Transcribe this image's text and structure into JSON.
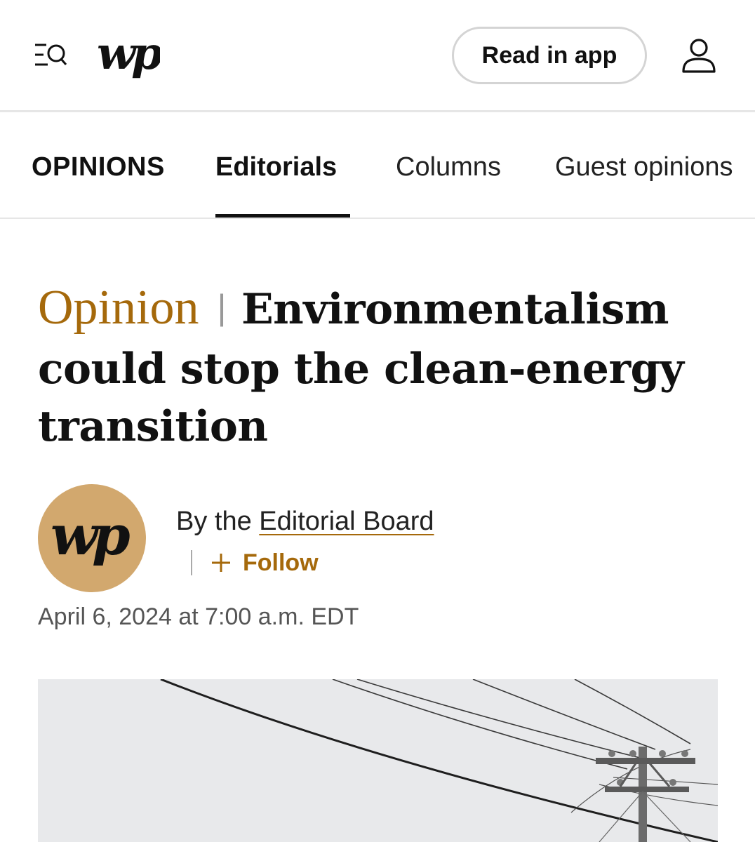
{
  "header": {
    "menu_icon": "menu-search-icon",
    "logo_text": "wp",
    "read_in_app_label": "Read in app",
    "account_icon": "user-icon"
  },
  "section_nav": {
    "items": [
      {
        "label": "OPINIONS",
        "active": false
      },
      {
        "label": "Editorials",
        "active": true
      },
      {
        "label": "Columns",
        "active": false
      },
      {
        "label": "Guest opinions",
        "active": false
      }
    ]
  },
  "article": {
    "kicker": "Opinion",
    "separator": "|",
    "headline": "Environmentalism could stop the clean-energy transition",
    "byline_prefix": "By the ",
    "author": "Editorial Board",
    "follow_label": "Follow",
    "date": "April 6, 2024 at 7:00 a.m. EDT",
    "avatar_logo_text": "wp",
    "photo_subject": "power-lines-photo"
  },
  "colors": {
    "accent": "#a5690b",
    "avatar_bg": "#d2a86e",
    "text": "#111111"
  }
}
